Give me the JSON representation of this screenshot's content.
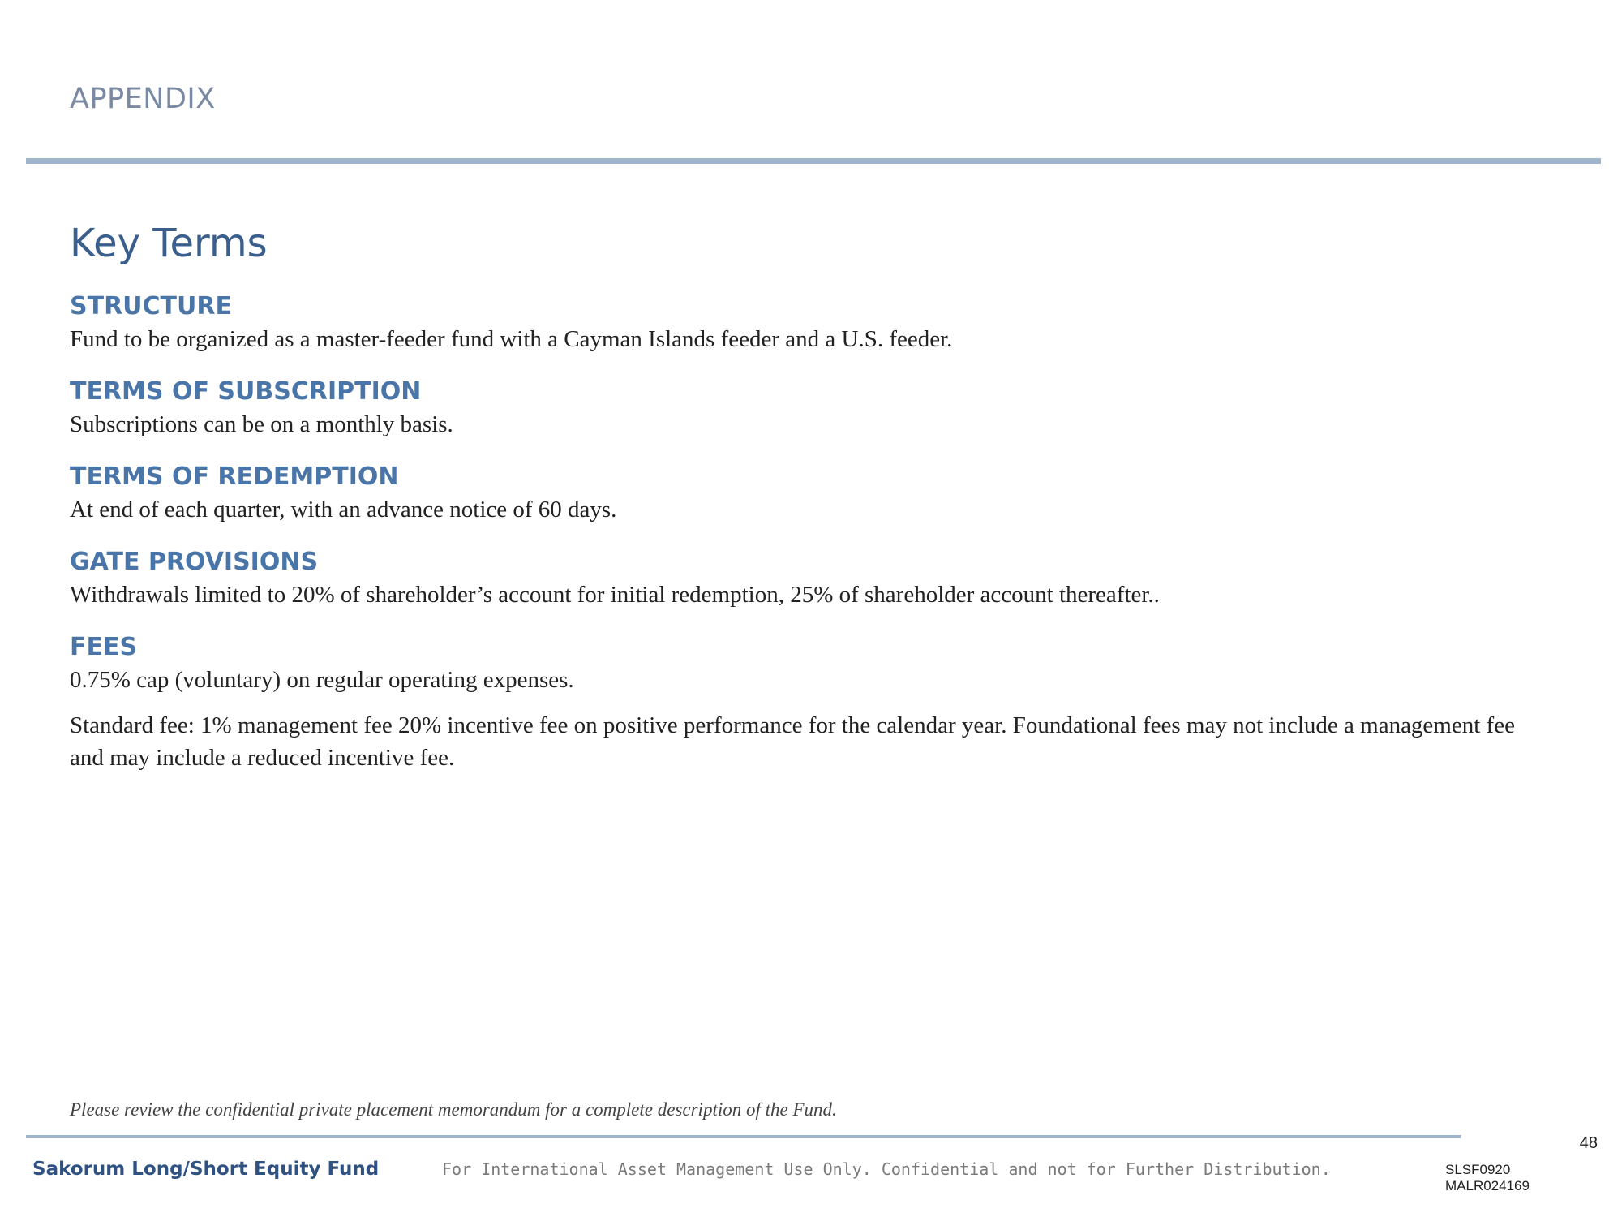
{
  "header": {
    "section_label": "APPENDIX"
  },
  "main": {
    "title": "Key Terms",
    "terms": [
      {
        "heading": "STRUCTURE",
        "text": "Fund to be organized as a master-feeder fund with a Cayman Islands feeder and a U.S. feeder."
      },
      {
        "heading": "TERMS OF SUBSCRIPTION",
        "text": "Subscriptions can be on a monthly basis."
      },
      {
        "heading": "TERMS OF REDEMPTION",
        "text": "At end of each quarter, with an advance notice of 60 days."
      },
      {
        "heading": "GATE PROVISIONS",
        "text": "Withdrawals limited to 20% of shareholder’s account for initial redemption, 25% of shareholder account thereafter.."
      },
      {
        "heading": "FEES",
        "text": "0.75% cap (voluntary) on regular operating expenses.",
        "text2": "Standard fee: 1% management fee 20% incentive fee on positive performance for the calendar year. Foundational fees may not include a management fee and may include a reduced incentive fee."
      }
    ]
  },
  "footer": {
    "disclaimer": "Please review the confidential private placement memorandum for a complete description of the Fund.",
    "fund_name": "Sakorum Long/Short Equity Fund",
    "notice": "For International Asset Management Use Only. Confidential and not for Further Distribution.",
    "page_number": "48",
    "doc_code_1": "SLSF0920",
    "doc_code_2": "MALR024169"
  }
}
